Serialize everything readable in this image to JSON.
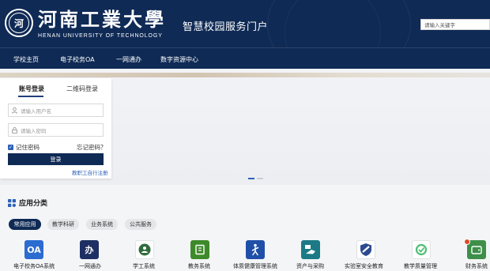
{
  "header": {
    "logo_emblem_text": "河",
    "logo_cn": "河南工業大學",
    "logo_en": "HENAN UNIVERSITY OF TECHNOLOGY",
    "portal_title": "智慧校园服务门户",
    "search_placeholder": "请输入关键字"
  },
  "nav": {
    "items": [
      {
        "label": "学校主页"
      },
      {
        "label": "电子校务OA"
      },
      {
        "label": "一网通办"
      },
      {
        "label": "数字资源中心"
      }
    ]
  },
  "login": {
    "tab_account": "账号登录",
    "tab_qrcode": "二维码登录",
    "username_placeholder": "请输入用户名",
    "password_placeholder": "请输入密码",
    "remember_label": "记住密码",
    "forgot_label": "忘记密码？",
    "submit_label": "登录",
    "register_label": "教职工自行注册"
  },
  "banner": {
    "slide_count": 2,
    "active_slide": 1
  },
  "apps": {
    "section_title": "应用分类",
    "categories": [
      {
        "label": "常用应用",
        "active": true
      },
      {
        "label": "教学科研",
        "active": false
      },
      {
        "label": "业务系统",
        "active": false
      },
      {
        "label": "公共服务",
        "active": false
      }
    ],
    "items": [
      {
        "label": "电子校务OA系统",
        "icon": "oa-icon",
        "icon_text": "OA",
        "color": "#2c6bd0"
      },
      {
        "label": "一网通办",
        "icon": "one-stop-icon",
        "icon_text": "办",
        "color": "#1d2f63"
      },
      {
        "label": "学工系统",
        "icon": "student-affairs-icon",
        "icon_text": "",
        "color": "#2f6b3c"
      },
      {
        "label": "教务系统",
        "icon": "academic-affairs-icon",
        "icon_text": "",
        "color": "#3e8a2a"
      },
      {
        "label": "体质健康管理系统",
        "icon": "fitness-icon",
        "icon_text": "",
        "color": "#1f4fa8"
      },
      {
        "label": "资产与采购",
        "icon": "assets-procurement-icon",
        "icon_text": "",
        "color": "#1c7a86"
      },
      {
        "label": "实验室安全教育",
        "icon": "lab-safety-icon",
        "icon_text": "",
        "color": "#2b4a8f"
      },
      {
        "label": "教学质量管理",
        "icon": "teaching-quality-icon",
        "icon_text": "",
        "color": "#4dbf73"
      },
      {
        "label": "财务系统",
        "icon": "finance-icon",
        "icon_text": "",
        "color": "#3d8f4a"
      }
    ]
  },
  "colors": {
    "header_bg": "#0f2a55",
    "accent": "#2d62b8"
  }
}
